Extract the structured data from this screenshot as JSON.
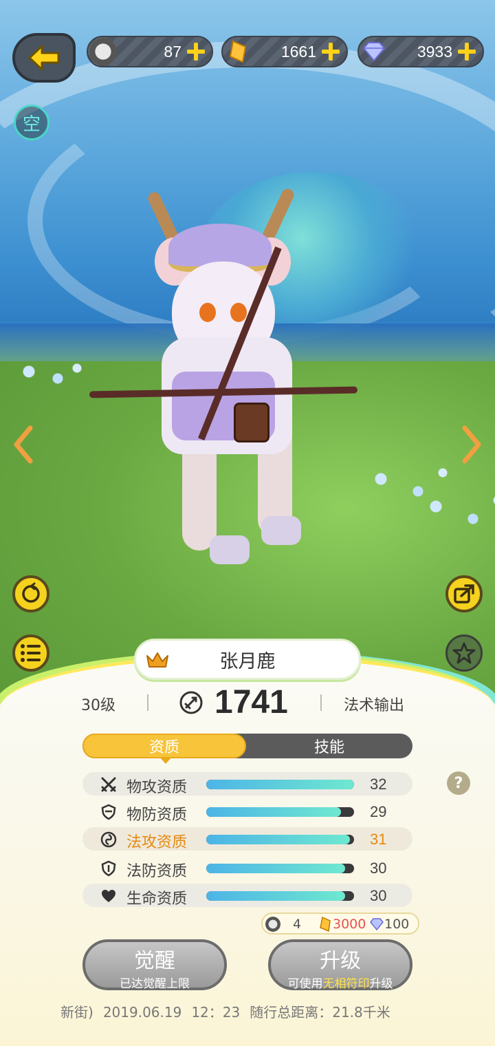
{
  "resources": [
    {
      "icon": "pet-token-icon",
      "value": "87"
    },
    {
      "icon": "crystal-icon",
      "value": "1661"
    },
    {
      "icon": "diamond-icon",
      "value": "3933"
    }
  ],
  "space_button": "空",
  "pet": {
    "name": "张月鹿",
    "level": "30级",
    "power": "1741",
    "role": "法术输出"
  },
  "tabs": {
    "aptitude": "资质",
    "skills": "技能"
  },
  "stats": [
    {
      "icon": "sword-icon",
      "label": "物攻资质",
      "value": "32",
      "fill": 1.0
    },
    {
      "icon": "shield-icon",
      "label": "物防资质",
      "value": "29",
      "fill": 0.91
    },
    {
      "icon": "magic-swirl-icon",
      "label": "法攻资质",
      "value": "31",
      "fill": 0.97
    },
    {
      "icon": "shield-icon",
      "label": "法防资质",
      "value": "30",
      "fill": 0.94
    },
    {
      "icon": "heart-icon",
      "label": "生命资质",
      "value": "30",
      "fill": 0.94
    }
  ],
  "cost": {
    "token": "4",
    "crystal": "3000",
    "diamond": "100"
  },
  "awaken_button": {
    "label": "觉醒",
    "sub": "已达觉醒上限"
  },
  "upgrade_button": {
    "label": "升级",
    "sub_prefix": "可使用",
    "sub_highlight": "无相符印",
    "sub_suffix": "升级"
  },
  "footer": {
    "location": "新街)",
    "date": "2019.06.19",
    "time": "12：23",
    "distance_label": "随行总距离：",
    "distance": "21.8千米"
  },
  "colors": {
    "accent": "#f7c43a",
    "highlight_stat": "#e58a12",
    "plus": "#ffd21a"
  }
}
